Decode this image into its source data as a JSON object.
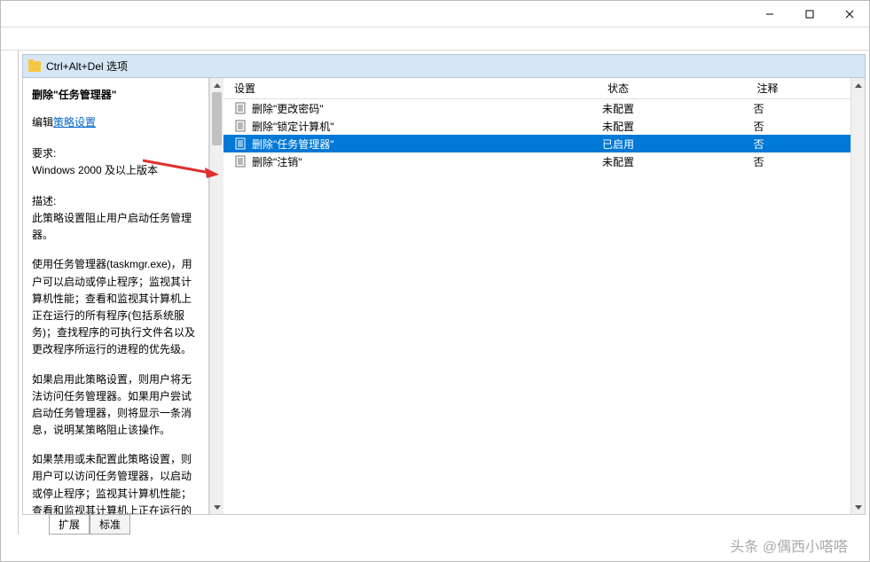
{
  "section_title": "Ctrl+Alt+Del 选项",
  "detail": {
    "title": "删除\"任务管理器\"",
    "edit_label": "编辑",
    "policy_link": "策略设置",
    "req_label": "要求:",
    "req_text": "Windows 2000 及以上版本",
    "desc_label": "描述:",
    "desc_text": "此策略设置阻止用户启动任务管理器。",
    "para1": "使用任务管理器(taskmgr.exe)，用户可以启动或停止程序；监视其计算机性能；查看和监视其计算机上正在运行的所有程序(包括系统服务)；查找程序的可执行文件名以及更改程序所运行的进程的优先级。",
    "para2": "如果启用此策略设置，则用户将无法访问任务管理器。如果用户尝试启动任务管理器，则将显示一条消息，说明某策略阻止该操作。",
    "para3": "如果禁用或未配置此策略设置，则用户可以访问任务管理器，以启动或停止程序；监视其计算机性能；查看和监视其计算机上正在运行的所有程序(包括系统服务)；查找程"
  },
  "columns": {
    "setting": "设置",
    "status": "状态",
    "note": "注释"
  },
  "rows": [
    {
      "name": "删除\"更改密码\"",
      "status": "未配置",
      "note": "否",
      "selected": false
    },
    {
      "name": "删除\"锁定计算机\"",
      "status": "未配置",
      "note": "否",
      "selected": false
    },
    {
      "name": "删除\"任务管理器\"",
      "status": "已启用",
      "note": "否",
      "selected": true
    },
    {
      "name": "删除\"注销\"",
      "status": "未配置",
      "note": "否",
      "selected": false
    }
  ],
  "tabs": {
    "extended": "扩展",
    "standard": "标准"
  },
  "watermark": "头条 @偶西小嗒嗒"
}
